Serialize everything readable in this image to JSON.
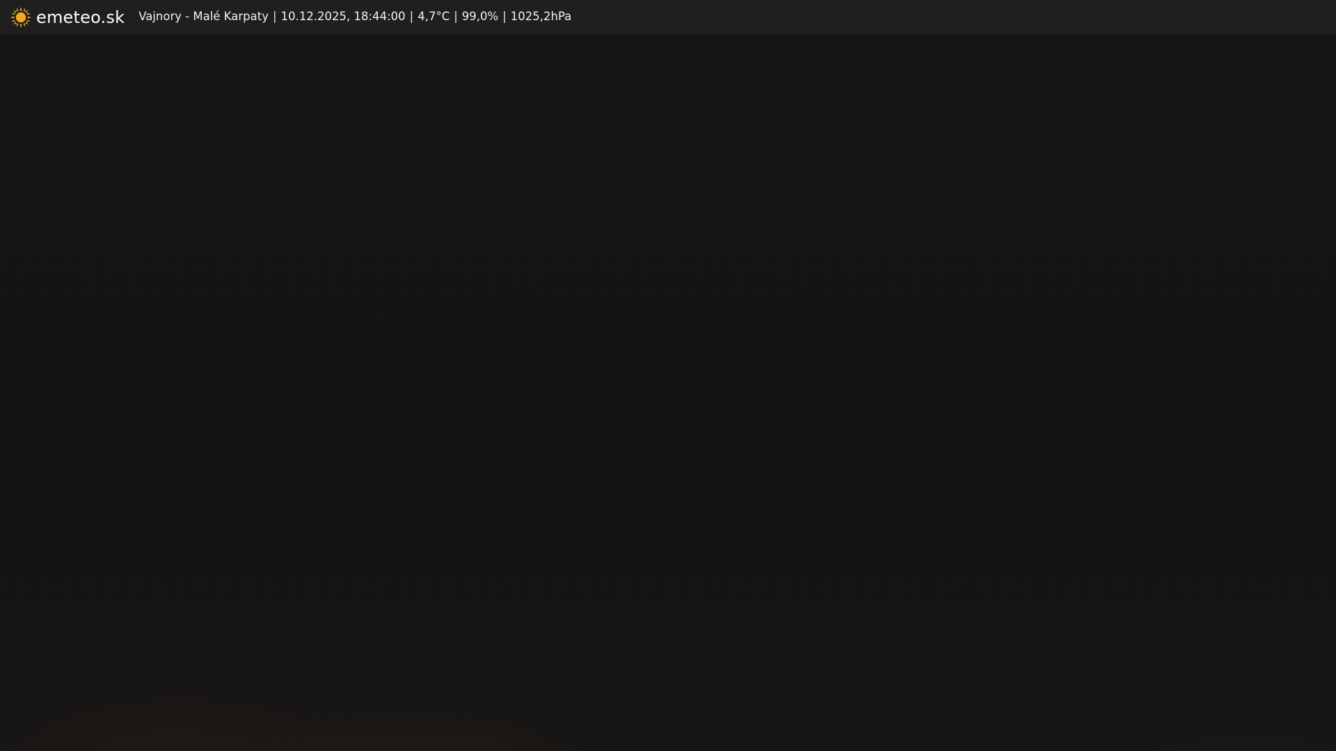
{
  "header": {
    "brand": "emeteo.sk",
    "location": "Vajnory - Malé Karpaty",
    "datetime": "10.12.2025, 18:44:00",
    "temperature": "4,7°C",
    "humidity": "99,0%",
    "pressure": "1025,2hPa",
    "separator": "|"
  },
  "colors": {
    "topbar": "#1f1f1f",
    "sun_icon": "#f6a623",
    "text": "#ffffff"
  },
  "icons": {
    "logo": "sun-icon"
  }
}
